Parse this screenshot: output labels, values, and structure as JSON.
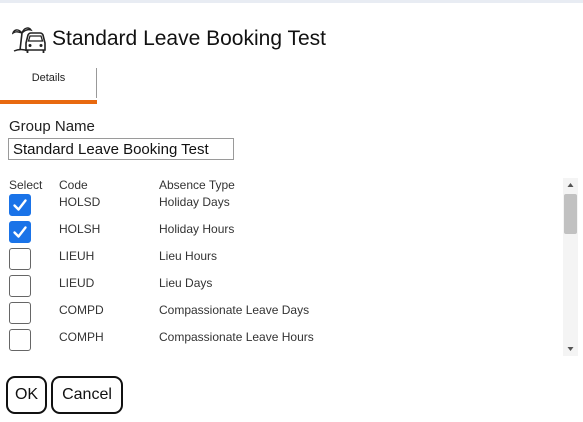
{
  "header": {
    "title": "Standard Leave Booking Test"
  },
  "tabs": [
    {
      "label": "Details",
      "active": true
    }
  ],
  "form": {
    "group_name_label": "Group Name",
    "group_name_value": "Standard Leave Booking Test"
  },
  "table": {
    "columns": {
      "select": "Select",
      "code": "Code",
      "type": "Absence Type"
    },
    "rows": [
      {
        "checked": true,
        "code": "HOLSD",
        "type": "Holiday Days"
      },
      {
        "checked": true,
        "code": "HOLSH",
        "type": "Holiday Hours"
      },
      {
        "checked": false,
        "code": "LIEUH",
        "type": "Lieu Hours"
      },
      {
        "checked": false,
        "code": "LIEUD",
        "type": "Lieu Days"
      },
      {
        "checked": false,
        "code": "COMPD",
        "type": "Compassionate Leave Days"
      },
      {
        "checked": false,
        "code": "COMPH",
        "type": "Compassionate Leave Hours"
      },
      {
        "checked": false,
        "code": "",
        "type": ""
      }
    ]
  },
  "buttons": {
    "ok_label": "OK",
    "cancel_label": "Cancel"
  },
  "icons": {
    "header_icon": "beach-car-icon",
    "scroll_up": "triangle-up-icon",
    "scroll_down": "triangle-down-icon",
    "checkbox_check": "check-icon"
  },
  "colors": {
    "accent_tab": "#e8690f",
    "checkbox_checked": "#1a73e8"
  }
}
